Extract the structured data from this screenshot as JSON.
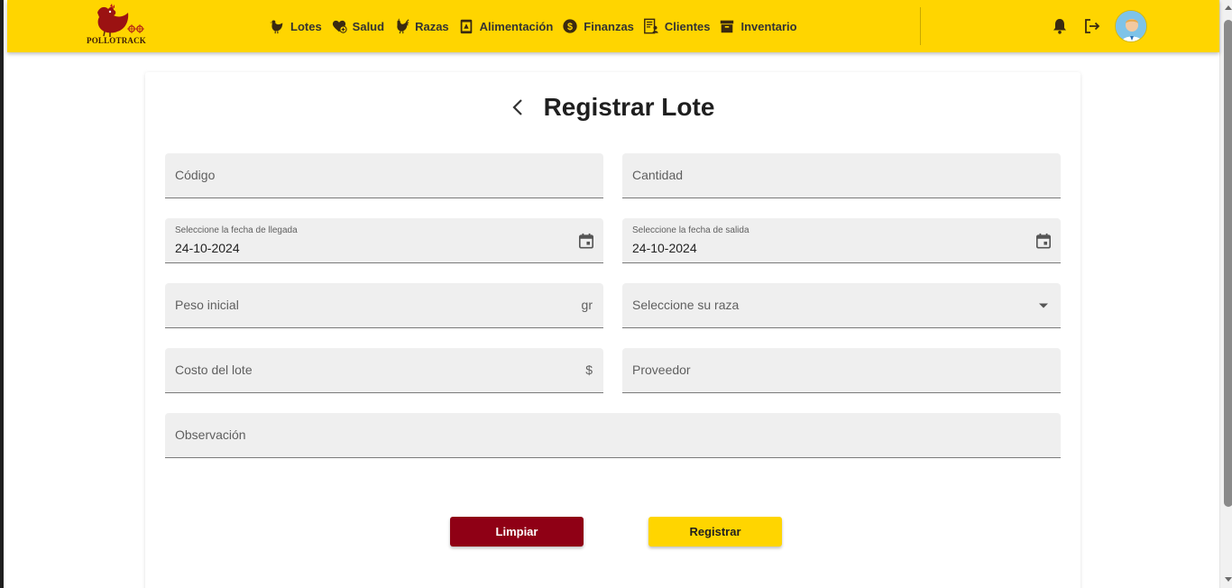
{
  "brand": {
    "name": "POLLOTRACK"
  },
  "nav": {
    "items": [
      {
        "label": "Lotes",
        "icon": "hen-icon"
      },
      {
        "label": "Salud",
        "icon": "health-heart-icon"
      },
      {
        "label": "Razas",
        "icon": "rooster-icon"
      },
      {
        "label": "Alimentación",
        "icon": "feed-bag-icon"
      },
      {
        "label": "Finanzas",
        "icon": "dollar-coin-icon"
      },
      {
        "label": "Clientes",
        "icon": "client-card-icon"
      },
      {
        "label": "Inventario",
        "icon": "archive-box-icon"
      }
    ],
    "actions": [
      "bell-icon",
      "logout-icon",
      "user-avatar"
    ]
  },
  "form": {
    "title": "Registrar Lote",
    "fields": {
      "codigo": {
        "placeholder": "Código"
      },
      "cantidad": {
        "placeholder": "Cantidad"
      },
      "fecha_llegada": {
        "label": "Seleccione la fecha de llegada",
        "value": "24-10-2024"
      },
      "fecha_salida": {
        "label": "Seleccione la fecha de salida",
        "value": "24-10-2024"
      },
      "peso_inicial": {
        "placeholder": "Peso inicial",
        "suffix": "gr"
      },
      "raza": {
        "placeholder": "Seleccione su raza"
      },
      "costo": {
        "placeholder": "Costo del lote",
        "suffix": "$"
      },
      "proveedor": {
        "placeholder": "Proveedor"
      },
      "observacion": {
        "placeholder": "Observación"
      }
    },
    "buttons": {
      "clear": "Limpiar",
      "submit": "Registrar"
    }
  },
  "colors": {
    "primary": "#ffd500",
    "danger": "#8f0015",
    "field_bg": "#efefef"
  }
}
